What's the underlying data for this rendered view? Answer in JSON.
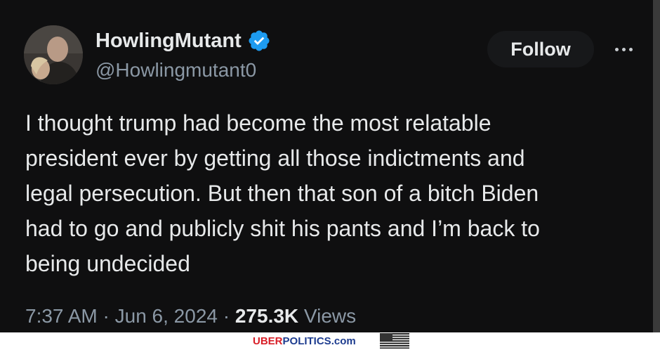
{
  "tweet": {
    "display_name": "HowlingMutant",
    "handle": "@Howlingmutant0",
    "follow_label": "Follow",
    "more_icon": "more-horizontal-icon",
    "verified_icon": "verified-badge-icon",
    "text": "I thought trump had become the most relatable\npresident ever by getting all those indictments and\nlegal persecution.  But then that son of a bitch Biden\nhad to go and publicly shit his pants and I’m back to\nbeing undecided",
    "time": "7:37 AM",
    "separator_1": " · ",
    "date": "Jun 6, 2024",
    "separator_2": " · ",
    "views_count": "275.3K",
    "views_label": " Views"
  },
  "watermark": {
    "uber": "UBER",
    "politics": "POLITICS",
    "dotcom": ".com"
  },
  "colors": {
    "background": "#0f0f10",
    "primary_text": "#e7e9ea",
    "secondary_text": "#8b98a5",
    "verified_blue": "#1d9bf0",
    "follow_bg": "#17181a",
    "watermark_red": "#d81e27",
    "watermark_blue": "#1d3c8f"
  }
}
